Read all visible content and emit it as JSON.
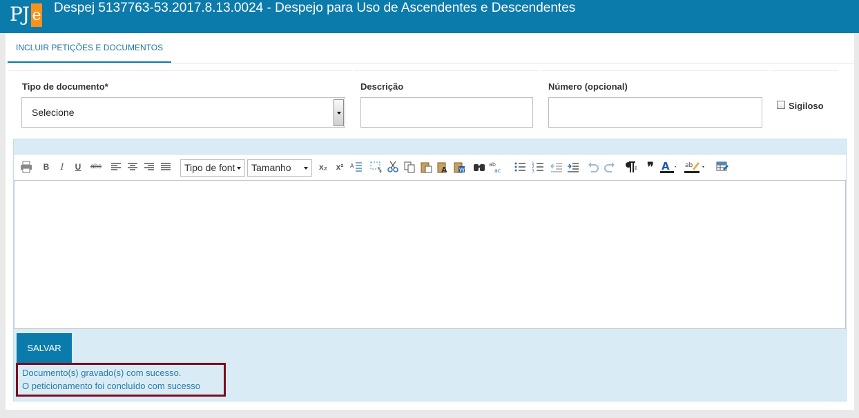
{
  "header": {
    "logo_text_a": "PJ",
    "logo_text_b": "e",
    "title": "Despej 5137763-53.2017.8.13.0024 - Despejo para Uso de Ascendentes e Descendentes"
  },
  "tabs": [
    {
      "label": "INCLUIR PETIÇÕES E DOCUMENTOS",
      "active": true
    }
  ],
  "form": {
    "tipo_label": "Tipo de documento*",
    "tipo_value": "Selecione",
    "descricao_label": "Descrição",
    "descricao_value": "",
    "numero_label": "Número (opcional)",
    "numero_value": "",
    "sigiloso_label": "Sigiloso",
    "sigiloso_checked": false
  },
  "editor": {
    "font_select": "Tipo de font",
    "size_select": "Tamanho",
    "bold": "B",
    "italic": "I",
    "underline": "U",
    "strike": "abc",
    "subscript": "x₂",
    "superscript": "x²",
    "quote": "❞",
    "content": ""
  },
  "actions": {
    "save_label": "SALVAR"
  },
  "messages": [
    "Documento(s) gravado(s) com sucesso.",
    "O peticionamento foi concluído com sucesso"
  ],
  "colors": {
    "brand": "#0b7bac",
    "logo_accent": "#f7931d",
    "message_border": "#7c0b20",
    "message_text": "#2a7aa8"
  }
}
